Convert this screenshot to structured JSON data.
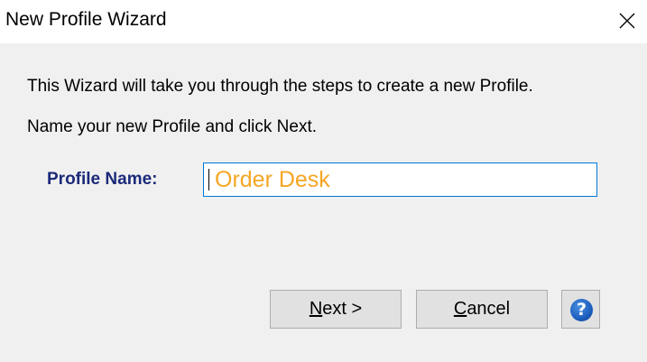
{
  "window": {
    "title": "New Profile Wizard"
  },
  "content": {
    "intro_text": "This Wizard will take you through the steps to create a new Profile.",
    "instruction_text": "Name your new Profile and click Next."
  },
  "form": {
    "profile_name_label": "Profile Name:",
    "profile_name_value": "Order Desk",
    "input_text_color": "#f5a623",
    "label_color": "#1c2a7a"
  },
  "buttons": {
    "next_mnemonic": "N",
    "next_rest": "ext >",
    "cancel_mnemonic": "C",
    "cancel_rest": "ancel",
    "help_glyph": "?"
  },
  "icons": {
    "close": "close-icon",
    "help": "help-icon"
  }
}
